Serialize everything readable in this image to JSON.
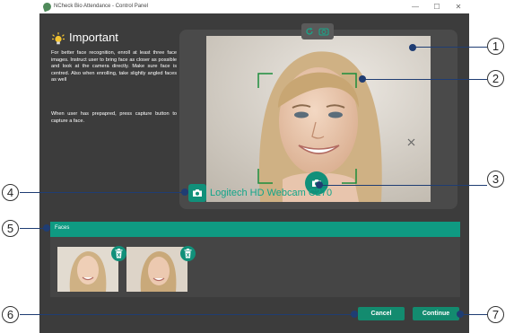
{
  "window": {
    "title": "NCheck Bio Attendance - Control Panel",
    "minimize_glyph": "—",
    "maximize_glyph": "☐",
    "close_glyph": "✕"
  },
  "important": {
    "heading": "Important",
    "paragraph1": "For better face recognition, enroll at least three face images. Instruct user to bring face as closer as possible and look at the camera directly. Make sure face is centred. Also when enrolling, take slightly angled faces as well",
    "paragraph2": "When user has prepapred, press capture button to capture a face."
  },
  "camera": {
    "device_name": "Logitech HD Webcam C270",
    "refresh_icon": "refresh-icon",
    "settings_icon": "camera-settings-icon"
  },
  "faces": {
    "title": "Faces",
    "count": 2
  },
  "buttons": {
    "cancel": "Cancel",
    "continue": "Continue"
  },
  "callouts": [
    "1",
    "2",
    "3",
    "4",
    "5",
    "6",
    "7"
  ],
  "colors": {
    "accent": "#0f9a82",
    "window_bg": "#3c3c3c",
    "callout": "#1f3d73"
  }
}
